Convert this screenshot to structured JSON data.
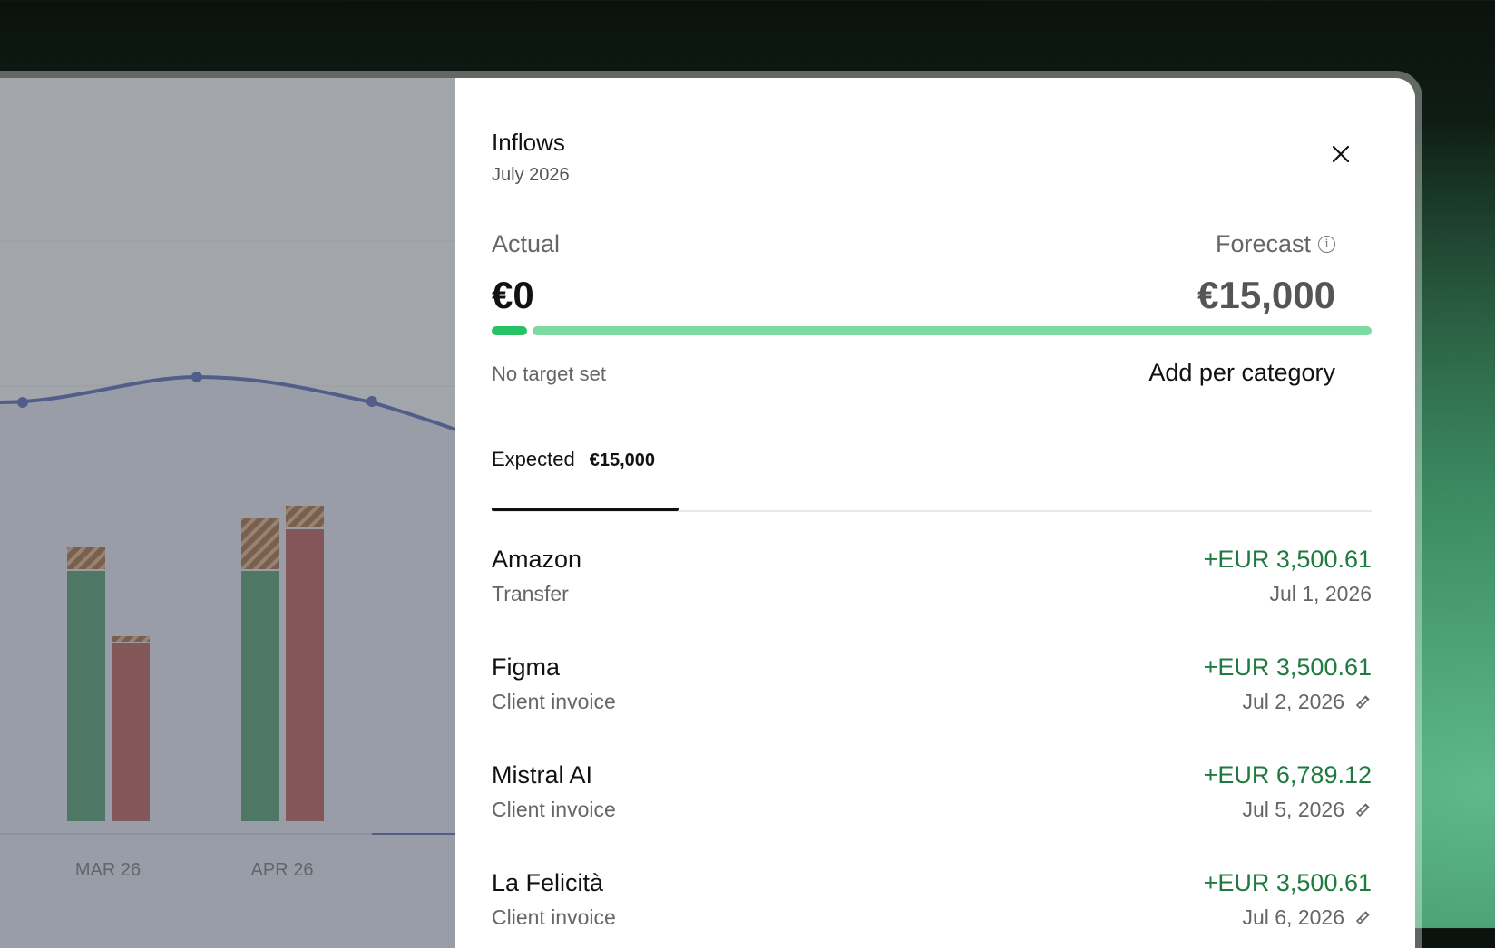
{
  "chart": {
    "x_labels": [
      "MAR 26",
      "APR 26"
    ]
  },
  "panel": {
    "title": "Inflows",
    "subtitle": "July 2026",
    "actual_label": "Actual",
    "forecast_label": "Forecast",
    "actual_amount": "€0",
    "forecast_amount": "€15,000",
    "actual_progress_fraction": 0.04,
    "target_text": "No target set",
    "add_per_category_label": "Add per category",
    "tab": {
      "label": "Expected",
      "count": "€15,000"
    },
    "transactions": [
      {
        "name": "Amazon",
        "category": "Transfer",
        "amount": "+EUR 3,500.61",
        "date": "Jul 1, 2026",
        "recurring": false
      },
      {
        "name": "Figma",
        "category": "Client invoice",
        "amount": "+EUR 3,500.61",
        "date": "Jul 2, 2026",
        "recurring": true
      },
      {
        "name": "Mistral AI",
        "category": "Client invoice",
        "amount": "+EUR 6,789.12",
        "date": "Jul 5, 2026",
        "recurring": true
      },
      {
        "name": "La Felicità",
        "category": "Client invoice",
        "amount": "+EUR 3,500.61",
        "date": "Jul 6, 2026",
        "recurring": true
      }
    ]
  },
  "colors": {
    "inflow_green": "#1e7a3e",
    "bar_green": "#4f9a6e",
    "bar_red": "#b85a55",
    "progress_actual": "#27c264",
    "progress_forecast": "#7dd9a2"
  }
}
